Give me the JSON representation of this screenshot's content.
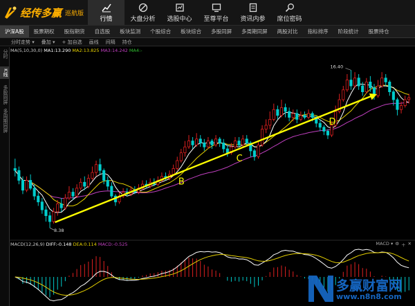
{
  "app": {
    "title": "经传多赢",
    "edition": "巡航版"
  },
  "nav": [
    {
      "label": "行情",
      "icon": "chart-trend-icon",
      "active": true
    },
    {
      "label": "大盘分析",
      "icon": "compass-icon"
    },
    {
      "label": "选股中心",
      "icon": "stock-select-icon"
    },
    {
      "label": "至尊平台",
      "icon": "monitor-icon"
    },
    {
      "label": "资讯内参",
      "icon": "document-icon"
    },
    {
      "label": "席位密码",
      "icon": "search-icon"
    }
  ],
  "tabs": [
    "沪深A股",
    "股票期权",
    "股指期货",
    "自选股",
    "板块监测",
    "个股综合",
    "板块综合",
    "多股同屏",
    "多周期同屏",
    "两股对比",
    "指标排序",
    "阶段统计",
    "股票持仓"
  ],
  "toolbar": {
    "intraday": "分时走势",
    "overlay": "叠加",
    "add": "加自选",
    "draw": "画线",
    "interval": "间隔",
    "holdings": "持仓"
  },
  "sidebar": {
    "intraday": "分时",
    "kline": "K线",
    "multi": "多股同屏",
    "multi_period": "多周期同屏"
  },
  "ma_legend": {
    "header": "MA(5,10,30,0)",
    "ma1": "MA1:13.290",
    "ma2": "MA2:13.825",
    "ma3": "MA3:14.242",
    "ma4": "MA4:-"
  },
  "macd_legend": {
    "header": "MACD(12,26,9)",
    "diff": "DIFF:-0.148",
    "dea": "DEA:0.114",
    "macd": "MACD:-0.525"
  },
  "macd_ctrl": {
    "label": "MACD"
  },
  "annotations": {
    "high": "16.40",
    "low": "8.38",
    "b": "B",
    "c": "C",
    "d": "D"
  },
  "watermark": {
    "text": "多赢财富网",
    "url": "www.n8n8.com"
  },
  "colors": {
    "up": "#e02020",
    "down": "#00cccc",
    "ma1": "#ffffff",
    "ma2": "#e6d000",
    "ma3": "#c040c0",
    "arrow": "#ffff00",
    "brand": "#ffb000",
    "watermark": "#1565c0"
  },
  "chart_data": {
    "type": "candlestick",
    "title": "",
    "price_axis": {
      "min": 8.38,
      "max": 16.4
    },
    "candles": [
      [
        11.4,
        11.3,
        11.9,
        11.0
      ],
      [
        11.3,
        10.8,
        11.5,
        10.6
      ],
      [
        10.8,
        10.3,
        11.0,
        10.1
      ],
      [
        10.3,
        10.8,
        11.0,
        10.2
      ],
      [
        10.8,
        10.4,
        11.1,
        10.3
      ],
      [
        10.4,
        10.0,
        10.6,
        9.8
      ],
      [
        10.0,
        9.7,
        10.2,
        9.5
      ],
      [
        9.7,
        9.3,
        9.9,
        9.1
      ],
      [
        9.3,
        9.0,
        9.5,
        8.7
      ],
      [
        9.0,
        8.7,
        9.2,
        8.38
      ],
      [
        8.7,
        9.2,
        9.4,
        8.6
      ],
      [
        9.2,
        9.6,
        9.8,
        9.0
      ],
      [
        9.6,
        9.4,
        9.9,
        9.2
      ],
      [
        9.4,
        9.9,
        10.1,
        9.3
      ],
      [
        9.9,
        10.2,
        10.5,
        9.8
      ],
      [
        10.2,
        10.0,
        10.4,
        9.8
      ],
      [
        10.0,
        10.4,
        10.6,
        9.9
      ],
      [
        10.4,
        10.7,
        10.9,
        10.3
      ],
      [
        10.7,
        10.5,
        11.0,
        10.3
      ],
      [
        10.5,
        10.9,
        11.1,
        10.4
      ],
      [
        10.9,
        11.2,
        11.5,
        10.8
      ],
      [
        11.2,
        11.6,
        11.8,
        11.0
      ],
      [
        11.6,
        11.3,
        11.9,
        11.1
      ],
      [
        11.3,
        10.8,
        11.4,
        10.6
      ],
      [
        10.8,
        10.5,
        11.0,
        10.3
      ],
      [
        10.5,
        10.0,
        10.7,
        9.9
      ],
      [
        10.0,
        9.7,
        10.1,
        9.5
      ],
      [
        9.7,
        10.0,
        10.2,
        9.6
      ],
      [
        10.0,
        10.2,
        10.4,
        9.9
      ],
      [
        10.2,
        10.1,
        10.4,
        10.0
      ],
      [
        10.1,
        10.3,
        10.5,
        10.0
      ],
      [
        10.3,
        10.2,
        10.5,
        10.1
      ],
      [
        10.2,
        10.4,
        10.6,
        10.1
      ],
      [
        10.4,
        10.6,
        10.8,
        10.3
      ],
      [
        10.6,
        10.5,
        10.8,
        10.4
      ],
      [
        10.5,
        10.7,
        10.9,
        10.4
      ],
      [
        10.7,
        10.6,
        10.9,
        10.5
      ],
      [
        10.6,
        10.8,
        11.0,
        10.5
      ],
      [
        10.8,
        11.0,
        11.2,
        10.7
      ],
      [
        11.0,
        10.9,
        11.2,
        10.8
      ],
      [
        10.9,
        11.1,
        11.3,
        10.8
      ],
      [
        11.1,
        11.4,
        11.6,
        11.0
      ],
      [
        11.4,
        11.8,
        12.0,
        11.3
      ],
      [
        11.8,
        12.2,
        12.4,
        11.7
      ],
      [
        12.2,
        12.5,
        12.8,
        12.0
      ],
      [
        12.5,
        12.8,
        13.1,
        12.4
      ],
      [
        12.8,
        12.6,
        13.0,
        12.4
      ],
      [
        12.6,
        12.9,
        13.2,
        12.5
      ],
      [
        12.9,
        12.7,
        13.1,
        12.5
      ],
      [
        12.7,
        12.5,
        12.9,
        12.3
      ],
      [
        12.5,
        12.8,
        13.0,
        12.4
      ],
      [
        12.8,
        12.6,
        12.9,
        12.4
      ],
      [
        12.6,
        12.9,
        13.1,
        12.5
      ],
      [
        12.9,
        12.7,
        13.0,
        12.5
      ],
      [
        12.7,
        12.4,
        12.9,
        12.2
      ],
      [
        12.4,
        12.2,
        12.6,
        12.0
      ],
      [
        12.2,
        12.5,
        12.7,
        12.1
      ],
      [
        12.5,
        12.8,
        13.0,
        12.4
      ],
      [
        12.8,
        12.6,
        13.0,
        12.5
      ],
      [
        12.6,
        12.9,
        13.1,
        12.5
      ],
      [
        12.9,
        12.7,
        13.1,
        12.6
      ],
      [
        12.7,
        12.3,
        12.8,
        12.0
      ],
      [
        12.3,
        12.0,
        12.4,
        11.8
      ],
      [
        12.0,
        12.6,
        12.8,
        11.9
      ],
      [
        12.6,
        13.4,
        13.6,
        12.5
      ],
      [
        13.4,
        13.6,
        13.9,
        13.2
      ],
      [
        13.6,
        13.9,
        14.3,
        13.4
      ],
      [
        13.9,
        14.4,
        14.7,
        13.8
      ],
      [
        14.4,
        14.1,
        14.6,
        13.9
      ],
      [
        14.1,
        14.5,
        14.9,
        14.0
      ],
      [
        14.5,
        14.3,
        14.7,
        14.0
      ],
      [
        14.3,
        14.0,
        14.5,
        13.8
      ],
      [
        14.0,
        14.2,
        14.4,
        13.8
      ],
      [
        14.2,
        13.9,
        14.4,
        13.7
      ],
      [
        13.9,
        14.1,
        14.3,
        13.8
      ],
      [
        14.1,
        14.0,
        14.3,
        13.9
      ],
      [
        14.0,
        14.2,
        14.4,
        13.9
      ],
      [
        14.2,
        14.0,
        14.3,
        13.8
      ],
      [
        14.0,
        13.7,
        14.1,
        13.5
      ],
      [
        13.7,
        13.5,
        13.9,
        13.3
      ],
      [
        13.5,
        13.3,
        13.6,
        13.1
      ],
      [
        13.3,
        13.1,
        13.4,
        12.9
      ],
      [
        13.1,
        13.6,
        13.8,
        13.0
      ],
      [
        13.6,
        14.3,
        14.6,
        13.5
      ],
      [
        14.3,
        14.9,
        15.2,
        14.2
      ],
      [
        14.9,
        15.4,
        15.6,
        14.8
      ],
      [
        15.4,
        15.9,
        16.2,
        15.3
      ],
      [
        15.9,
        15.6,
        16.4,
        15.4
      ],
      [
        15.6,
        16.0,
        16.3,
        15.5
      ],
      [
        16.0,
        15.6,
        16.2,
        15.4
      ],
      [
        15.6,
        15.3,
        15.8,
        15.1
      ],
      [
        15.3,
        15.8,
        16.0,
        15.2
      ],
      [
        15.8,
        15.5,
        16.1,
        15.3
      ],
      [
        15.5,
        15.1,
        15.7,
        14.9
      ],
      [
        15.1,
        15.6,
        15.9,
        15.0
      ],
      [
        15.6,
        16.0,
        16.3,
        15.5
      ],
      [
        16.0,
        15.8,
        16.2,
        15.6
      ],
      [
        15.8,
        15.3,
        15.9,
        15.1
      ],
      [
        15.3,
        14.9,
        15.4,
        14.6
      ],
      [
        14.9,
        14.4,
        15.0,
        14.1
      ],
      [
        14.4,
        14.6,
        14.8,
        14.2
      ],
      [
        14.6,
        14.9,
        15.1,
        14.5
      ],
      [
        14.9,
        15.0,
        15.2,
        14.7
      ]
    ],
    "trend_line": {
      "from_index": 10,
      "to_index": 93
    },
    "labels": [
      {
        "text": "B",
        "index": 43
      },
      {
        "text": "C",
        "index": 58
      },
      {
        "text": "D",
        "index": 82
      }
    ],
    "macd": {
      "diff": -0.148,
      "dea": 0.114,
      "macd": -0.525
    }
  }
}
